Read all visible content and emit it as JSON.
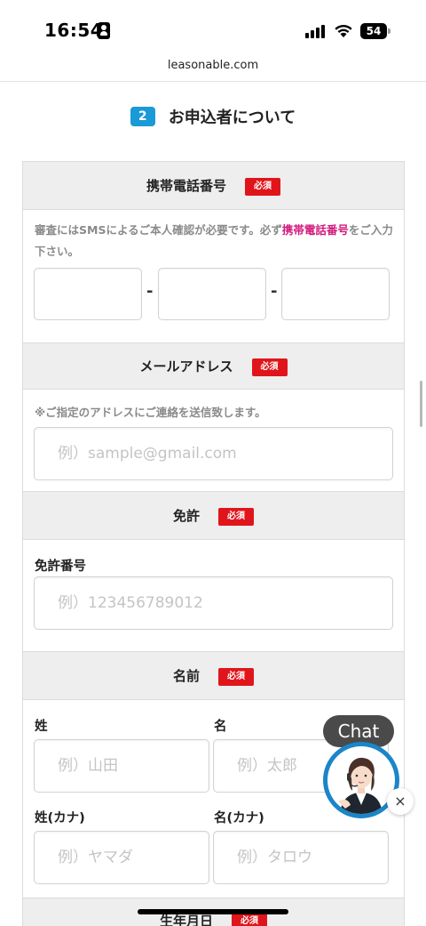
{
  "status_bar": {
    "time": "16:54",
    "battery": "54"
  },
  "browser": {
    "url": "leasonable.com"
  },
  "section": {
    "step": "2",
    "title": "お申込者について"
  },
  "phone": {
    "label": "携帯電話番号",
    "required": "必須",
    "note_before": "審査にはSMSによるご本人確認が必要です。必ず",
    "note_link": "携帯電話番号",
    "note_after": "をご入力下さい。",
    "separator": "-"
  },
  "email": {
    "label": "メールアドレス",
    "required": "必須",
    "note": "※ご指定のアドレスにご連絡を送信致します。",
    "placeholder": "例）sample@gmail.com"
  },
  "license": {
    "label": "免許",
    "required": "必須",
    "number_label": "免許番号",
    "number_placeholder": "例）123456789012"
  },
  "name": {
    "label": "名前",
    "required": "必須",
    "last_label": "姓",
    "first_label": "名",
    "last_placeholder": "例）山田",
    "first_placeholder": "例）太郎",
    "last_kana_label": "姓(カナ)",
    "first_kana_label": "名(カナ)",
    "last_kana_placeholder": "例）ヤマダ",
    "first_kana_placeholder": "例）タロウ"
  },
  "birthday": {
    "label": "生年月日",
    "required": "必須"
  },
  "chat": {
    "label": "Chat",
    "close": "×"
  },
  "colors": {
    "accent_blue": "#1a9ad6",
    "required_red": "#e0151b",
    "link_pink": "#d3197c",
    "header_gray": "#eeeeee"
  }
}
